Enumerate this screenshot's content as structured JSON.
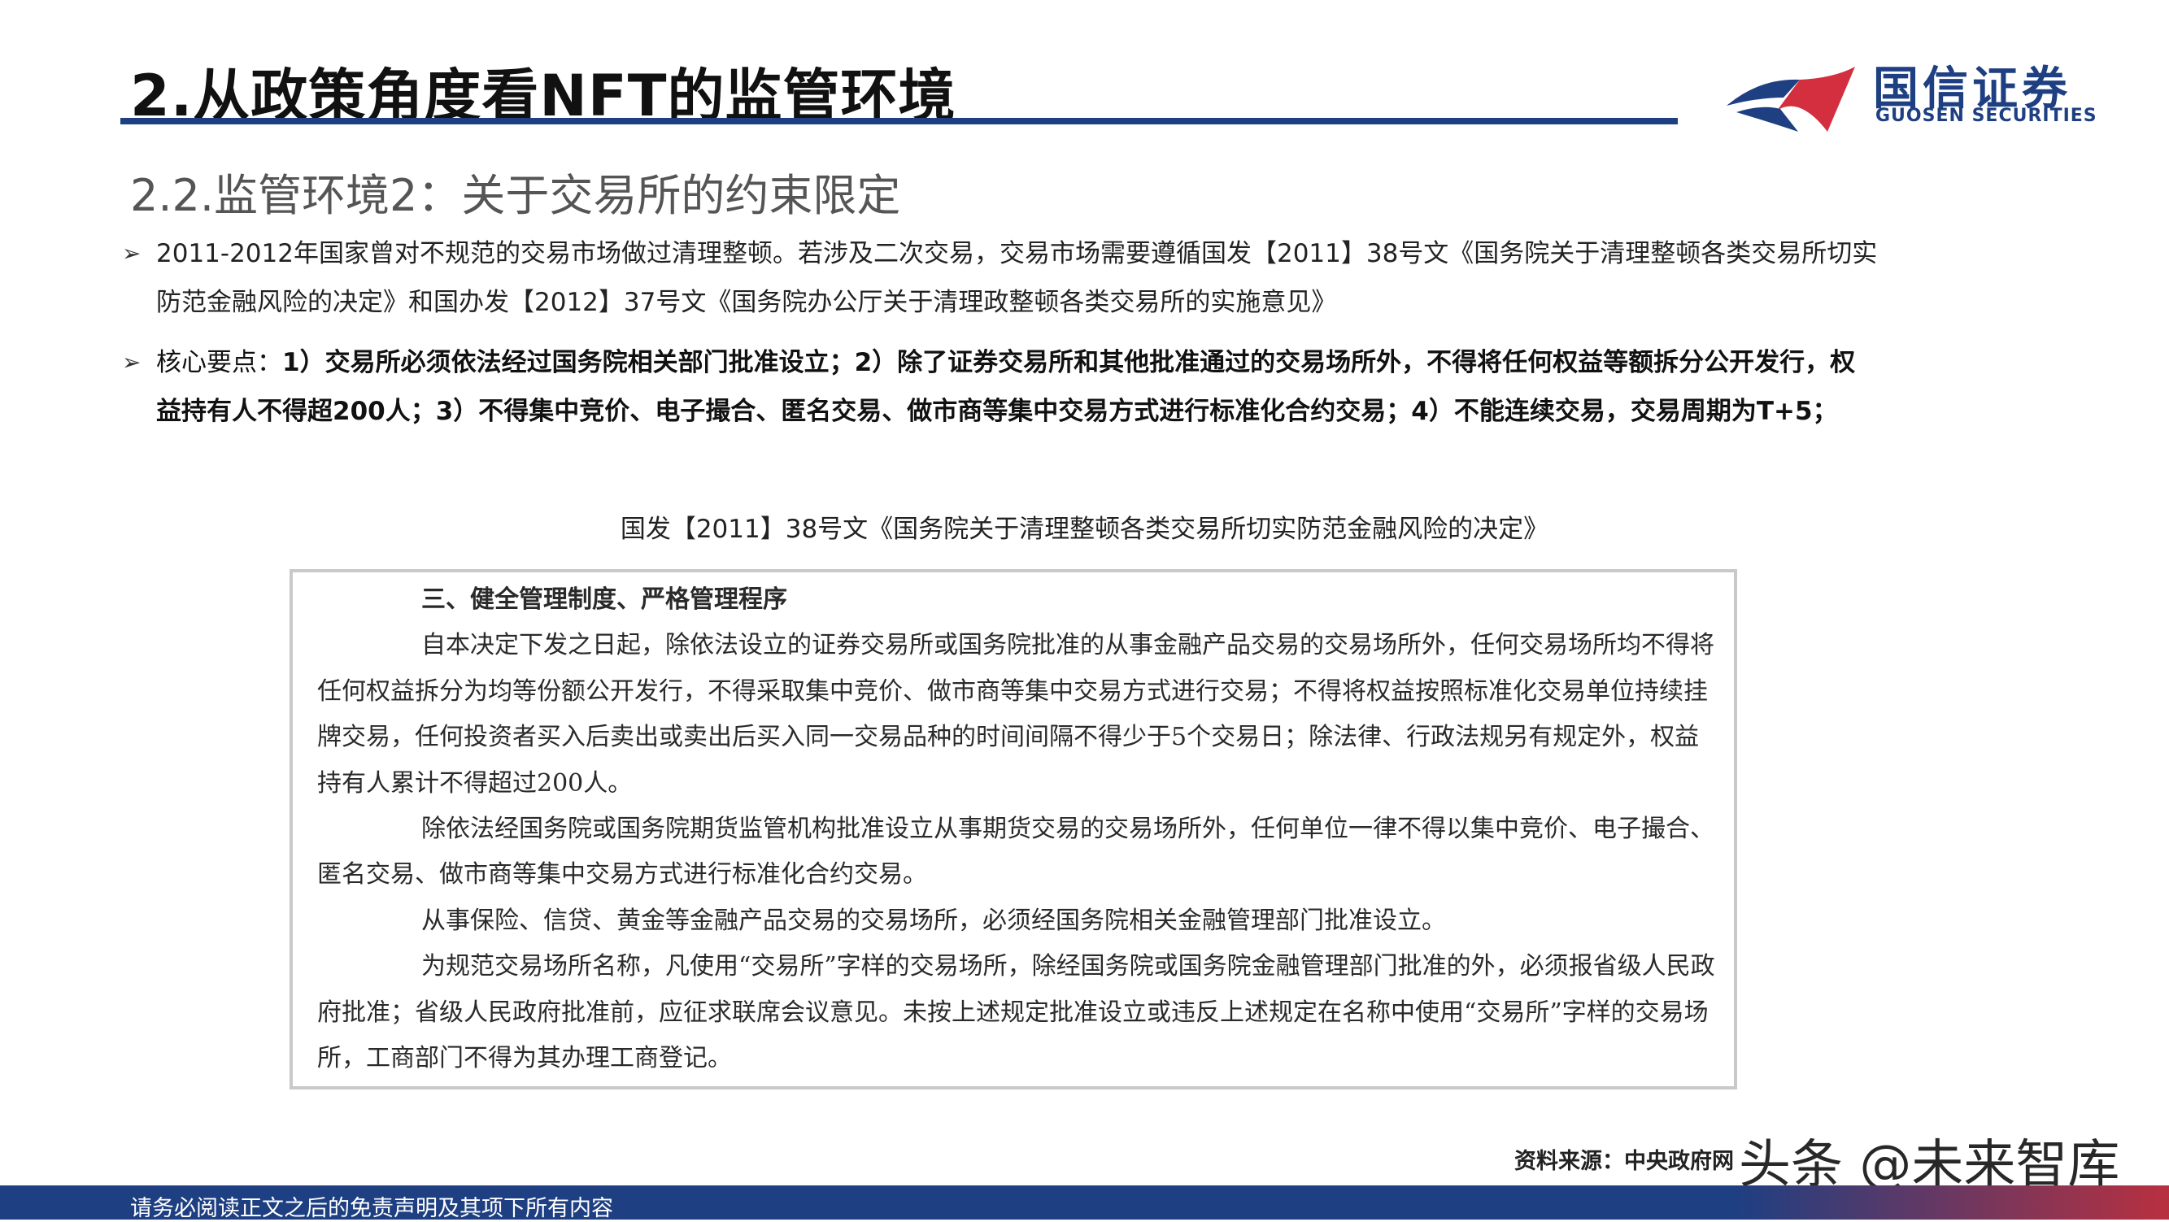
{
  "header": {
    "title": "2.从政策角度看NFT的监管环境",
    "logo_cn": "国信证券",
    "logo_en": "GUOSEN SECURITIES",
    "brand_color": "#1e3f82",
    "accent_color": "#d32f3f"
  },
  "subtitle": "2.2.监管环境2：关于交易所的约束限定",
  "bullets": [
    {
      "text": "2011-2012年国家曾对不规范的交易市场做过清理整顿。若涉及二次交易，交易市场需要遵循国发【2011】38号文《国务院关于清理整顿各类交易所切实防范金融风险的决定》和国办发【2012】37号文《国务院办公厅关于清理政整顿各类交易所的实施意见》"
    },
    {
      "lead": "核心要点：",
      "text": "1）交易所必须依法经过国务院相关部门批准设立；2）除了证券交易所和其他批准通过的交易场所外，不得将任何权益等额拆分公开发行，权益持有人不得超200人；3）不得集中竞价、电子撮合、匿名交易、做市商等集中交易方式进行标准化合约交易；4）不能连续交易，交易周期为T+5；"
    }
  ],
  "caption": "国发【2011】38号文《国务院关于清理整顿各类交易所切实防范金融风险的决定》",
  "document": {
    "heading": "三、健全管理制度、严格管理程序",
    "paragraphs": [
      "自本决定下发之日起，除依法设立的证券交易所或国务院批准的从事金融产品交易的交易场所外，任何交易场所均不得将任何权益拆分为均等份额公开发行，不得采取集中竞价、做市商等集中交易方式进行交易；不得将权益按照标准化交易单位持续挂牌交易，任何投资者买入后卖出或卖出后买入同一交易品种的时间间隔不得少于5个交易日；除法律、行政法规另有规定外，权益持有人累计不得超过200人。",
      "除依法经国务院或国务院期货监管机构批准设立从事期货交易的交易场所外，任何单位一律不得以集中竞价、电子撮合、匿名交易、做市商等集中交易方式进行标准化合约交易。",
      "从事保险、信贷、黄金等金融产品交易的交易场所，必须经国务院相关金融管理部门批准设立。",
      "为规范交易场所名称，凡使用“交易所”字样的交易场所，除经国务院或国务院金融管理部门批准的外，必须报省级人民政府批准；省级人民政府批准前，应征求联席会议意见。未按上述规定批准设立或违反上述规定在名称中使用“交易所”字样的交易场所，工商部门不得为其办理工商登记。"
    ]
  },
  "source": "资料来源：中央政府网",
  "watermark": "头条 @未来智库",
  "footer": "请务必阅读正文之后的免责声明及其项下所有内容"
}
